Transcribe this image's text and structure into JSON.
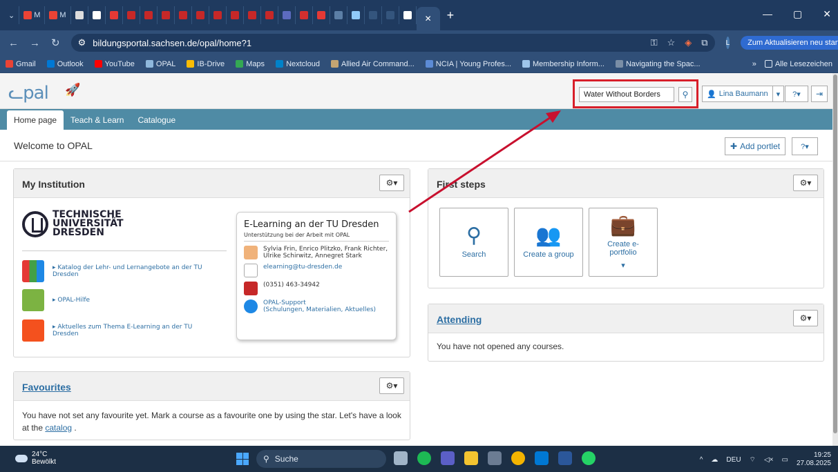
{
  "browser": {
    "url": "bildungsportal.sachsen.de/opal/home?1",
    "update_label": "Zum Aktualisieren neu starten",
    "profile_initial": "L",
    "bookmarks": [
      "Gmail",
      "Outlook",
      "YouTube",
      "OPAL",
      "IB-Drive",
      "Maps",
      "Nextcloud",
      "Allied Air Command...",
      "NCIA | Young Profes...",
      "Membership Inform...",
      "Navigating the Spac..."
    ],
    "all_bookmarks": "Alle Lesezeichen"
  },
  "opal": {
    "search_value": "Water Without Borders",
    "user_name": "Lina Baumann",
    "nav_tabs": [
      "Home page",
      "Teach & Learn",
      "Catalogue"
    ],
    "welcome": "Welcome to OPAL",
    "add_portlet": "Add portlet",
    "my_institution": {
      "title": "My Institution",
      "logo_lines": [
        "TECHNISCHE",
        "UNIVERSITÄT",
        "DRESDEN"
      ],
      "links": [
        "▸ Katalog der Lehr- und Lernangebote an der TU Dresden",
        "▸ OPAL-Hilfe",
        "▸ Aktuelles zum Thema E-Learning an der TU Dresden"
      ],
      "card": {
        "title": "E-Learning an der TU Dresden",
        "subtitle": "Unterstützung bei der Arbeit mit OPAL",
        "people": "Sylvia Frin, Enrico Plitzko, Frank Richter, Ulrike Schirwitz, Annegret Stark",
        "email": "elearning@tu-dresden.de",
        "phone": "(0351) 463-34942",
        "support": "OPAL-Support",
        "support_sub": "(Schulungen, Materialien, Aktuelles)"
      }
    },
    "first_steps": {
      "title": "First steps",
      "tiles": [
        "Search",
        "Create a group",
        "Create e-portfolio"
      ]
    },
    "attending": {
      "title": "Attending",
      "text": "You have not opened any courses."
    },
    "favourites": {
      "title": "Favourites",
      "text": "You have not set any favourite yet. Mark a course as a favourite one by using the star. Let's have a look at the",
      "link": "catalog",
      "tail": " ."
    }
  },
  "taskbar": {
    "temp": "24°C",
    "weather": "Bewölkt",
    "search": "Suche",
    "lang": "DEU",
    "time": "19:25",
    "date": "27.08.2025"
  }
}
